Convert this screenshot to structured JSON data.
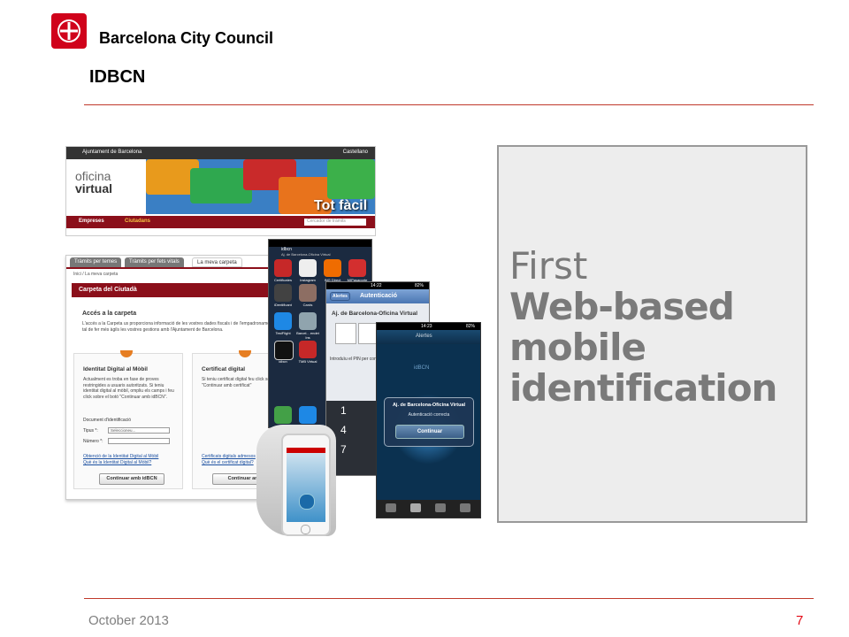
{
  "header": {
    "org_name": "Barcelona City Council",
    "slide_title": "IDBCN"
  },
  "footer": {
    "date": "October 2013",
    "page_number": "7"
  },
  "message": {
    "line1": "First",
    "line2": "Web-based",
    "line3": "mobile",
    "line4": "identification"
  },
  "portal": {
    "topbar_left": "Ajuntament de Barcelona",
    "topbar_right": "Castellano",
    "logo_line1": "oficina",
    "logo_line2": "virtual",
    "banner_text": "Tot fàcil",
    "nav_items": [
      "Empreses",
      "Ciutadans"
    ],
    "search_placeholder": "Cercador de tràmits",
    "tabs": [
      "Tràmits per temes",
      "Tràmits per fets vitals",
      "La meva carpeta"
    ],
    "breadcrumb": "Inici / La meva carpeta",
    "section_title": "Carpeta del Ciutadà",
    "access_heading": "Accés a la carpeta",
    "access_text": "L'accés a la Carpeta us proporciona informació de les vostres dades fiscals i de l'empadronament, per tal de fer més àgils les vostres gestions amb l'Ajuntament de Barcelona.",
    "card1": {
      "heading": "Identitat Digital al Mòbil",
      "text": "Actualment es troba en fase de proves restringides a usuaris autoritzats. Si teniu identitat digital al mòbil, ompliu els camps i feu click sobre el botó \"Continuar amb idBCN\".",
      "doc_label": "Document d'identificació",
      "type_label": "Tipus *:",
      "type_value": "Seleccioneu...",
      "number_label": "Número *:",
      "link1": "Obtenció de la Identitat Digital al Mòbil",
      "link2": "Què és la Identitat Digital al Mòbil?",
      "button": "Continuar amb idBCN"
    },
    "card2": {
      "heading": "Certificat digital",
      "text": "Si teniu certificat digital feu click sobre el botó \"Continuar amb certificat\"",
      "link1": "Certificats digitals admesos",
      "link2": "Què és el certificat digital?",
      "button": "Continuar amb"
    }
  },
  "phone_home": {
    "title": "idbcn",
    "subtitle": "Aj. de Barcelona-Oficina Virtual",
    "apps": [
      "Certificates",
      "Instagram",
      "ING Direct",
      "MIPasaporte",
      "iDentificant",
      "Cards",
      "TestFlight",
      "Barcel... endet Ins",
      "idbcn",
      "TMB Virtual"
    ]
  },
  "phone_pin": {
    "time": "14:22",
    "battery": "82%",
    "back": "Alertes",
    "nav_title": "Autenticació",
    "heading": "Aj. de Barcelona-Oficina Virtual",
    "pin_prompt": "Introduïu el PIN per continuar",
    "keys": [
      "1",
      "4",
      "7"
    ]
  },
  "phone_alert": {
    "time": "14:23",
    "battery": "82%",
    "nav_title": "Alertes",
    "brand": "idBCN",
    "alert_title": "Aj. de Barcelona-Oficina Virtual",
    "alert_text": "Autenticació correcta",
    "alert_button": "Continuar"
  }
}
